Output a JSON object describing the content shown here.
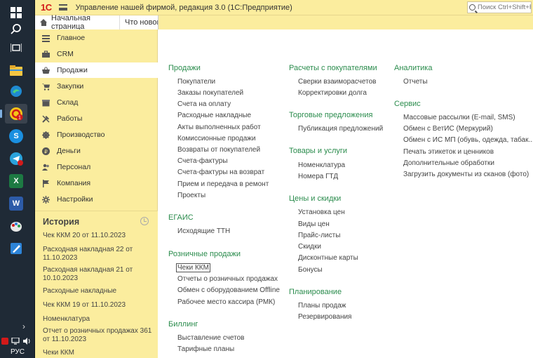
{
  "taskbar": {
    "language": "РУС"
  },
  "topbar": {
    "logo": "1С",
    "title": "Управление нашей фирмой, редакция 3.0  (1С:Предприятие)",
    "search_placeholder": "Поиск Ctrl+Shift+F"
  },
  "tabs": {
    "home": "Начальная страница",
    "whats_new": "Что нового"
  },
  "sidebar": {
    "items": [
      "Главное",
      "CRM",
      "Продажи",
      "Закупки",
      "Склад",
      "Работы",
      "Производство",
      "Деньги",
      "Персонал",
      "Компания",
      "Настройки"
    ],
    "active": "Продажи"
  },
  "history": {
    "title": "История",
    "items": [
      "Чек ККМ 20 от 11.10.2023",
      "Расходная накладная 22 от 11.10.2023",
      "Расходная накладная 21 от 10.10.2023",
      "Расходные накладные",
      "Чек ККМ 19 от 11.10.2023",
      "Номенклатура",
      "Отчет о розничных продажах 361 от 11.10.2023",
      "Чеки ККМ"
    ]
  },
  "sections": {
    "prodazhi": {
      "title": "Продажи",
      "links": [
        "Покупатели",
        "Заказы покупателей",
        "Счета на оплату",
        "Расходные накладные",
        "Акты выполненных работ",
        "Комиссионные продажи",
        "Возвраты от покупателей",
        "Счета-фактуры",
        "Счета-фактуры на возврат",
        "Прием и передача в ремонт",
        "Проекты"
      ]
    },
    "egais": {
      "title": "ЕГАИС",
      "links": [
        "Исходящие ТТН"
      ]
    },
    "retail": {
      "title": "Розничные продажи",
      "links": [
        "Чеки ККМ",
        "Отчеты о розничных продажах",
        "Обмен с оборудованием Offline",
        "Рабочее место кассира (РМК)"
      ]
    },
    "billing": {
      "title": "Биллинг",
      "links": [
        "Выставление счетов",
        "Тарифные планы"
      ]
    },
    "settlements": {
      "title": "Расчеты с покупателями",
      "links": [
        "Сверки взаиморасчетов",
        "Корректировки долга"
      ]
    },
    "offers": {
      "title": "Торговые предложения",
      "links": [
        "Публикация предложений"
      ]
    },
    "goods": {
      "title": "Товары и услуги",
      "links": [
        "Номенклатура",
        "Номера ГТД"
      ]
    },
    "prices": {
      "title": "Цены и скидки",
      "links": [
        "Установка цен",
        "Виды цен",
        "Прайс-листы",
        "Скидки",
        "Дисконтные карты",
        "Бонусы"
      ]
    },
    "planning": {
      "title": "Планирование",
      "links": [
        "Планы продаж",
        "Резервирования"
      ]
    },
    "analytics": {
      "title": "Аналитика",
      "links": [
        "Отчеты"
      ]
    },
    "service": {
      "title": "Сервис",
      "links": [
        "Массовые рассылки (E-mail, SMS)",
        "Обмен с ВетИС (Меркурий)",
        "Обмен с ИС МП (обувь, одежда, табак...)",
        "Печать этикеток и ценников",
        "Дополнительные обработки",
        "Загрузить документы из сканов (фото)"
      ]
    }
  },
  "colors": {
    "header_bg": "#fbed9e",
    "section_title": "#2b8c4d",
    "logo": "#d21a1a"
  }
}
